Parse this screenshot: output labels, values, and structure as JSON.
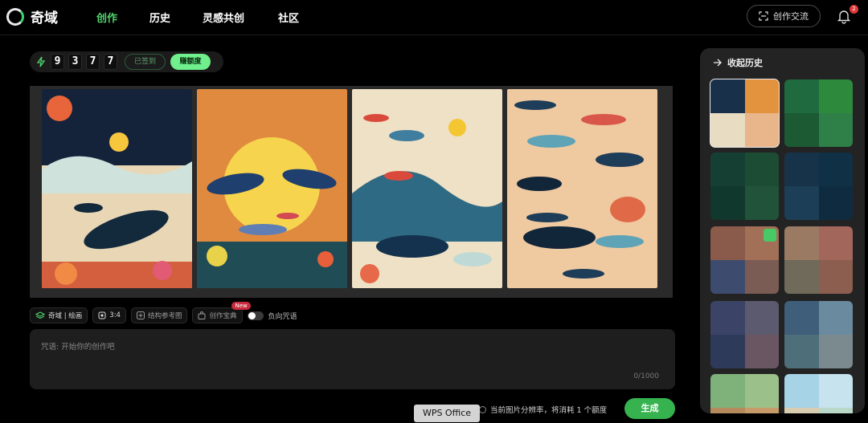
{
  "app": {
    "name": "奇域"
  },
  "nav": {
    "items": [
      {
        "label": "创作",
        "active": true
      },
      {
        "label": "历史"
      },
      {
        "label": "灵感共创"
      },
      {
        "label": "社区"
      }
    ]
  },
  "header": {
    "exchange_label": "创作交流",
    "notification_count": "2"
  },
  "credits": {
    "digits": [
      "9",
      "3",
      "7",
      "7"
    ],
    "signed_label": "已签到",
    "earn_label": "赚额度"
  },
  "gallery": {
    "images": [
      {
        "icon": "whale-art-1"
      },
      {
        "icon": "dolphin-art-2"
      },
      {
        "icon": "whale-art-3"
      },
      {
        "icon": "whale-pattern-4"
      }
    ]
  },
  "toolbar": {
    "model_label": "奇域 | 绘画",
    "ratio_label": "3:4",
    "reference_label": "结构参考图",
    "treasure_label": "创作宝典",
    "new_badge": "New",
    "negative_label": "负向咒语"
  },
  "prompt": {
    "placeholder": "咒语: 开始你的创作吧",
    "counter": "0/1000"
  },
  "footer": {
    "cost_text": "当前图片分辨率，将消耗 1 个额度",
    "generate_label": "生成",
    "taskbar_label": "WPS Office"
  },
  "history": {
    "title": "收起历史"
  },
  "colors": {
    "accent": "#4fd56d",
    "generate": "#36b34f",
    "panel": "#232323"
  }
}
